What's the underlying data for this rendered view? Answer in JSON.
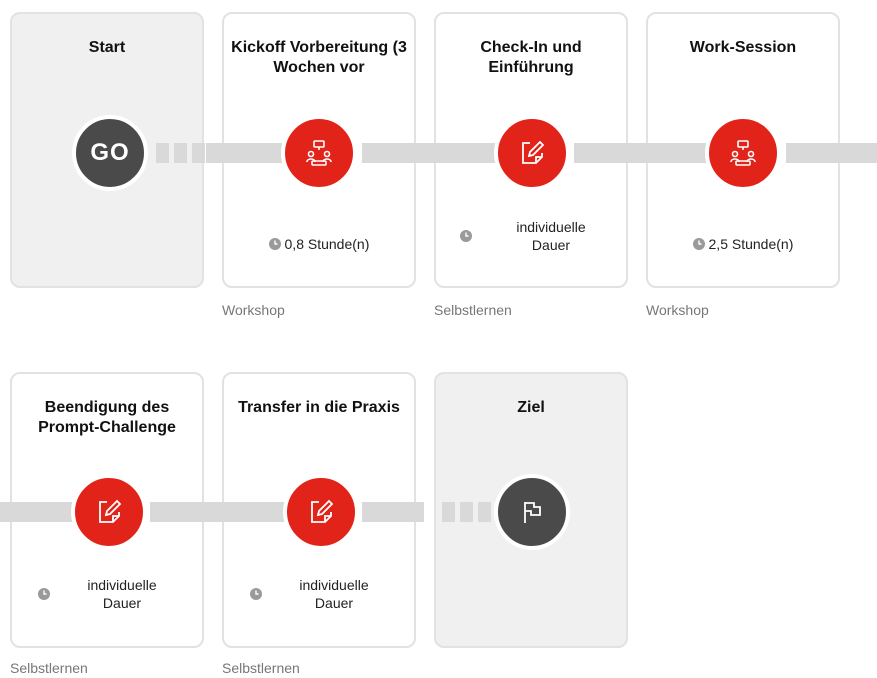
{
  "row1": {
    "steps": [
      {
        "title": "Start",
        "node": "go",
        "go_text": "GO"
      },
      {
        "title": "Kickoff Vorbereitung (3 Wochen vor",
        "icon": "workshop-icon",
        "duration": "0,8 Stunde(n)",
        "type": "Workshop"
      },
      {
        "title": "Check-In und Einführung",
        "icon": "edit-icon",
        "duration": "individuelle Dauer",
        "type": "Selbstlernen"
      },
      {
        "title": "Work-Session",
        "icon": "workshop-icon",
        "duration": "2,5 Stunde(n)",
        "type": "Workshop"
      }
    ]
  },
  "row2": {
    "steps": [
      {
        "title": "Beendigung des Prompt-Challenge",
        "icon": "edit-icon",
        "duration": "individuelle Dauer",
        "type": "Selbstlernen"
      },
      {
        "title": "Transfer in die Praxis",
        "icon": "edit-icon",
        "duration": "individuelle Dauer",
        "type": "Selbstlernen"
      },
      {
        "title": "Ziel",
        "node": "flag",
        "icon": "flag-icon"
      }
    ]
  },
  "colors": {
    "accent": "#e2231a",
    "dark_node": "#4a4a4a",
    "track": "#d9d9d9",
    "start_end_card": "#f0f0f0"
  }
}
